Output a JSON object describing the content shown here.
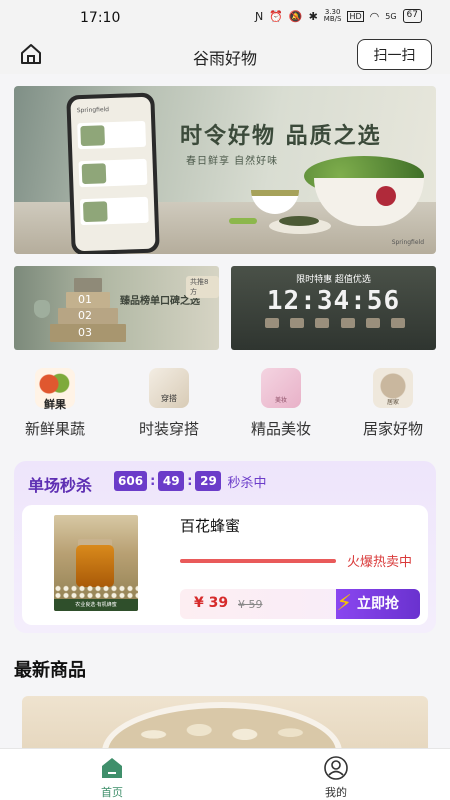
{
  "status_bar": {
    "time": "17:10",
    "network_speed_value": "3.30",
    "network_speed_unit": "MB/S",
    "hd": "HD",
    "signal": "5G",
    "battery": "67"
  },
  "navbar": {
    "title": "谷雨好物",
    "scan_label": "扫一扫"
  },
  "banner": {
    "title": "时令好物 品质之选",
    "subtitle": "春日鲜享 自然好味",
    "brand": "Springfield"
  },
  "sub_banners": {
    "left_text": "臻品榜单口碑之选",
    "left_badge": "共推8方",
    "podium_labels": [
      "01",
      "02",
      "03"
    ],
    "right_tag": "限时特惠 超值优选",
    "right_clock": "12:34:56"
  },
  "categories": [
    {
      "label": "新鲜果蔬",
      "icon_text": "鲜果"
    },
    {
      "label": "时装穿搭",
      "icon_text": "穿搭"
    },
    {
      "label": "精品美妆",
      "icon_text": "美妆"
    },
    {
      "label": "居家好物",
      "icon_text": "居家"
    }
  ],
  "seckill": {
    "title": "单场秒杀",
    "timer": [
      "606",
      "49",
      "29"
    ],
    "status": "秒杀中",
    "product": {
      "name": "百花蜂蜜",
      "hot_label": "火爆热卖中",
      "price": "¥ 39",
      "original_price": "¥ 59",
      "buy_label": "立即抢",
      "sold_fraction": 1.0,
      "image_caption": "农业良选·有机蜂蜜"
    }
  },
  "latest": {
    "title": "最新商品"
  },
  "tabbar": {
    "home_label": "首页",
    "mine_label": "我的"
  },
  "colors": {
    "accent_purple": "#6b3cc9",
    "price_red": "#d62b2b",
    "tab_active": "#3f8f6b"
  }
}
